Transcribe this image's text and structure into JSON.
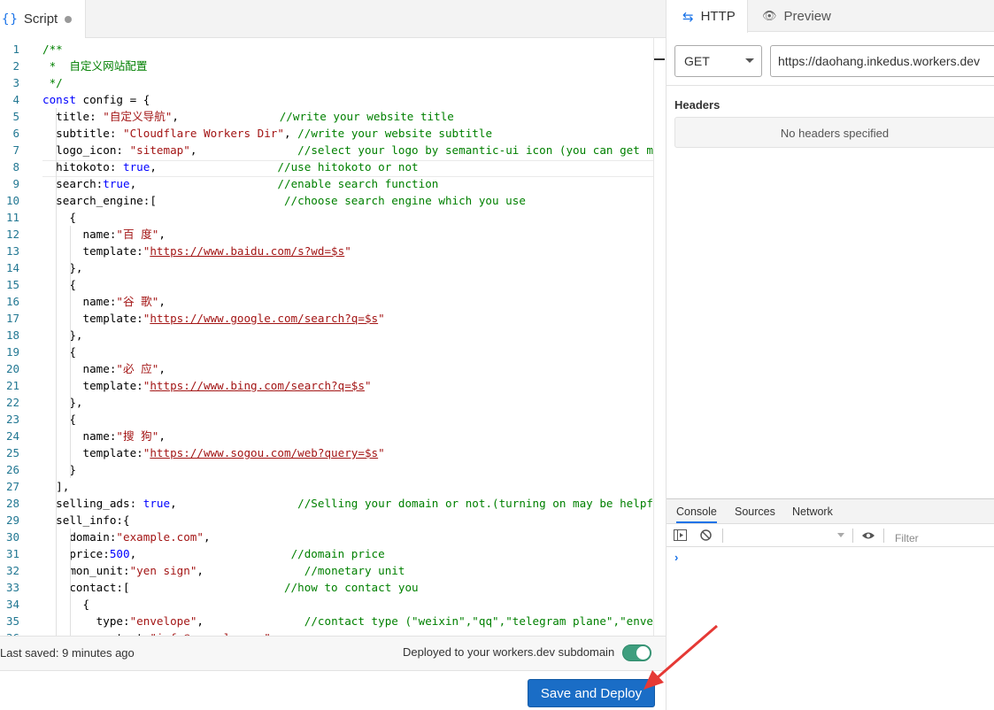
{
  "editor": {
    "tab_label": "Script",
    "tab_braces": "{}",
    "lines": [
      [
        [
          "/**",
          "c-comment"
        ]
      ],
      [
        [
          " *  自定义网站配置",
          "c-comment"
        ]
      ],
      [
        [
          " */",
          "c-comment"
        ]
      ],
      [
        [
          "const",
          "c-kw"
        ],
        [
          " config = {",
          ""
        ]
      ],
      [
        [
          "  title: ",
          ""
        ],
        [
          "\"自定义导航\"",
          "c-str"
        ],
        [
          ",               ",
          ""
        ],
        [
          "//write your website title",
          "c-comment"
        ]
      ],
      [
        [
          "  subtitle: ",
          ""
        ],
        [
          "\"Cloudflare Workers Dir\"",
          "c-str"
        ],
        [
          ", ",
          ""
        ],
        [
          "//write your website subtitle",
          "c-comment"
        ]
      ],
      [
        [
          "  logo_icon: ",
          ""
        ],
        [
          "\"sitemap\"",
          "c-str"
        ],
        [
          ",               ",
          ""
        ],
        [
          "//select your logo by semantic-ui icon (you can get more msg in:https://semantic-ui.com/elements/icon.html)",
          "c-comment"
        ]
      ],
      [
        [
          "  hitokoto: ",
          ""
        ],
        [
          "true",
          "c-kw"
        ],
        [
          ",                  ",
          ""
        ],
        [
          "//use hitokoto or not",
          "c-comment"
        ]
      ],
      [
        [
          "  search:",
          ""
        ],
        [
          "true",
          "c-kw"
        ],
        [
          ",                     ",
          ""
        ],
        [
          "//enable search function",
          "c-comment"
        ]
      ],
      [
        [
          "  search_engine:[                   ",
          ""
        ],
        [
          "//choose search engine which you use",
          "c-comment"
        ]
      ],
      [
        [
          "    {",
          ""
        ]
      ],
      [
        [
          "      name:",
          ""
        ],
        [
          "\"百 度\"",
          "c-str"
        ],
        [
          ",",
          ""
        ]
      ],
      [
        [
          "      template:",
          ""
        ],
        [
          "\"",
          "c-str"
        ],
        [
          "https://www.baidu.com/s?wd=$s",
          "c-url"
        ],
        [
          "\"",
          "c-str"
        ]
      ],
      [
        [
          "    },",
          ""
        ]
      ],
      [
        [
          "    {",
          ""
        ]
      ],
      [
        [
          "      name:",
          ""
        ],
        [
          "\"谷 歌\"",
          "c-str"
        ],
        [
          ",",
          ""
        ]
      ],
      [
        [
          "      template:",
          ""
        ],
        [
          "\"",
          "c-str"
        ],
        [
          "https://www.google.com/search?q=$s",
          "c-url"
        ],
        [
          "\"",
          "c-str"
        ]
      ],
      [
        [
          "    },",
          ""
        ]
      ],
      [
        [
          "    {",
          ""
        ]
      ],
      [
        [
          "      name:",
          ""
        ],
        [
          "\"必 应\"",
          "c-str"
        ],
        [
          ",",
          ""
        ]
      ],
      [
        [
          "      template:",
          ""
        ],
        [
          "\"",
          "c-str"
        ],
        [
          "https://www.bing.com/search?q=$s",
          "c-url"
        ],
        [
          "\"",
          "c-str"
        ]
      ],
      [
        [
          "    },",
          ""
        ]
      ],
      [
        [
          "    {",
          ""
        ]
      ],
      [
        [
          "      name:",
          ""
        ],
        [
          "\"搜 狗\"",
          "c-str"
        ],
        [
          ",",
          ""
        ]
      ],
      [
        [
          "      template:",
          ""
        ],
        [
          "\"",
          "c-str"
        ],
        [
          "https://www.sogou.com/web?query=$s",
          "c-url"
        ],
        [
          "\"",
          "c-str"
        ]
      ],
      [
        [
          "    }",
          ""
        ]
      ],
      [
        [
          "  ],",
          ""
        ]
      ],
      [
        [
          "  selling_ads: ",
          ""
        ],
        [
          "true",
          "c-kw"
        ],
        [
          ",                  ",
          ""
        ],
        [
          "//Selling your domain or not.(turning on may be helpful for selling this domain by showing some ads.)",
          "c-comment"
        ]
      ],
      [
        [
          "  sell_info:{",
          ""
        ]
      ],
      [
        [
          "    domain:",
          ""
        ],
        [
          "\"example.com\"",
          "c-str"
        ],
        [
          ",",
          ""
        ]
      ],
      [
        [
          "    price:",
          ""
        ],
        [
          "500",
          "c-kw"
        ],
        [
          ",                       ",
          ""
        ],
        [
          "//domain price",
          "c-comment"
        ]
      ],
      [
        [
          "    mon_unit:",
          ""
        ],
        [
          "\"yen sign\"",
          "c-str"
        ],
        [
          ",               ",
          ""
        ],
        [
          "//monetary unit",
          "c-comment"
        ]
      ],
      [
        [
          "    contact:[                       ",
          ""
        ],
        [
          "//how to contact you",
          "c-comment"
        ]
      ],
      [
        [
          "      {",
          ""
        ]
      ],
      [
        [
          "        type:",
          ""
        ],
        [
          "\"envelope\"",
          "c-str"
        ],
        [
          ",               ",
          ""
        ],
        [
          "//contact type (\"weixin\",\"qq\",\"telegram plane\",\"envelope\" or \"phone\")",
          "c-comment"
        ]
      ],
      [
        [
          "        content:",
          ""
        ],
        [
          "\"info@example.com\"",
          "c-str"
        ]
      ]
    ],
    "line_numbers": [
      "1",
      "2",
      "3",
      "4",
      "5",
      "6",
      "7",
      "8",
      "9",
      "10",
      "11",
      "12",
      "13",
      "14",
      "15",
      "16",
      "17",
      "18",
      "19",
      "20",
      "21",
      "22",
      "23",
      "24",
      "25",
      "26",
      "27",
      "28",
      "29",
      "30",
      "31",
      "32",
      "33",
      "34",
      "35",
      "36"
    ]
  },
  "status": {
    "last_saved": "Last saved: 9 minutes ago",
    "deployed": "Deployed to your workers.dev subdomain",
    "deployed_toggle_on": true,
    "toggle_color": "#3e9e7e"
  },
  "deploy_button": {
    "label": "Save and Deploy",
    "color": "#1a6dc6"
  },
  "right": {
    "tab_http": "HTTP",
    "tab_preview": "Preview",
    "method": "GET",
    "url": "https://daohang.inkedus.workers.dev",
    "headers_title": "Headers",
    "headers_empty": "No headers specified",
    "devtools": {
      "tabs": [
        "Console",
        "Sources",
        "Network"
      ],
      "active_tab": "Console",
      "filter_placeholder": "Filter",
      "prompt": "›"
    }
  },
  "annotation": {
    "arrow_color": "#e53935"
  }
}
